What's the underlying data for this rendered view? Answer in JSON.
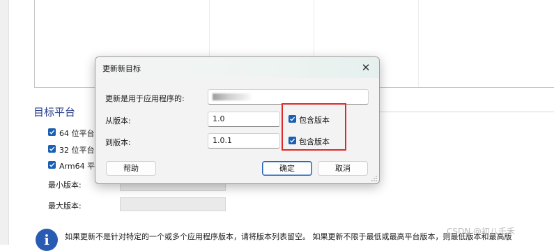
{
  "background": {
    "section_title": "目标平台",
    "platforms": [
      {
        "label": "64 位平台",
        "checked": true
      },
      {
        "label": "32 位平台",
        "checked": true
      },
      {
        "label": "Arm64 平台",
        "checked": true
      }
    ],
    "min_version_label": "最小版本:",
    "max_version_label": "最大版本:",
    "info_text": "如果更新不是针对特定的一个或多个应用程序版本，请将版本列表留空。 如果更新不限于最低或最高平台版本，则最低版本和最高版",
    "watermark": "CSDN @初八千禾"
  },
  "dialog": {
    "title": "更新新目标",
    "close_glyph": "✕",
    "app_label": "更新是用于应用程序的:",
    "app_value": "",
    "from_label": "从版本:",
    "from_value": "1.0",
    "to_label": "到版本:",
    "to_value": "1.0.1",
    "include_from": {
      "label": "包含版本",
      "checked": true
    },
    "include_to": {
      "label": "包含版本",
      "checked": true
    },
    "help_button": "帮助",
    "ok_button": "确定",
    "cancel_button": "取消"
  },
  "colors": {
    "accent": "#1a5fb4",
    "highlight": "#e02828",
    "section_title": "#2b3f8e"
  }
}
